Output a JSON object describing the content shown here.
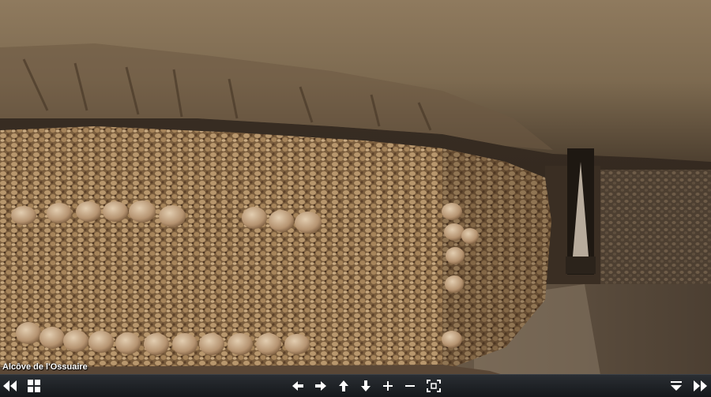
{
  "scene": {
    "caption": "Alcôve de l'Ossuaire"
  },
  "toolbar": {
    "buttons": [
      {
        "name": "previous-scene-button",
        "icon": "double-chevron-left-icon"
      },
      {
        "name": "thumbnails-button",
        "icon": "grid-icon"
      },
      {
        "name": "pan-left-button",
        "icon": "arrow-left-icon"
      },
      {
        "name": "pan-right-button",
        "icon": "arrow-right-icon"
      },
      {
        "name": "pan-up-button",
        "icon": "arrow-up-icon"
      },
      {
        "name": "pan-down-button",
        "icon": "arrow-down-icon"
      },
      {
        "name": "zoom-in-button",
        "icon": "plus-icon"
      },
      {
        "name": "zoom-out-button",
        "icon": "minus-icon"
      },
      {
        "name": "fullscreen-button",
        "icon": "fullscreen-icon"
      },
      {
        "name": "hide-controls-button",
        "icon": "collapse-down-icon"
      },
      {
        "name": "next-scene-button",
        "icon": "double-chevron-right-icon"
      }
    ]
  },
  "colors": {
    "toolbar_bg": "#1f2327",
    "icon": "#ffffff"
  }
}
